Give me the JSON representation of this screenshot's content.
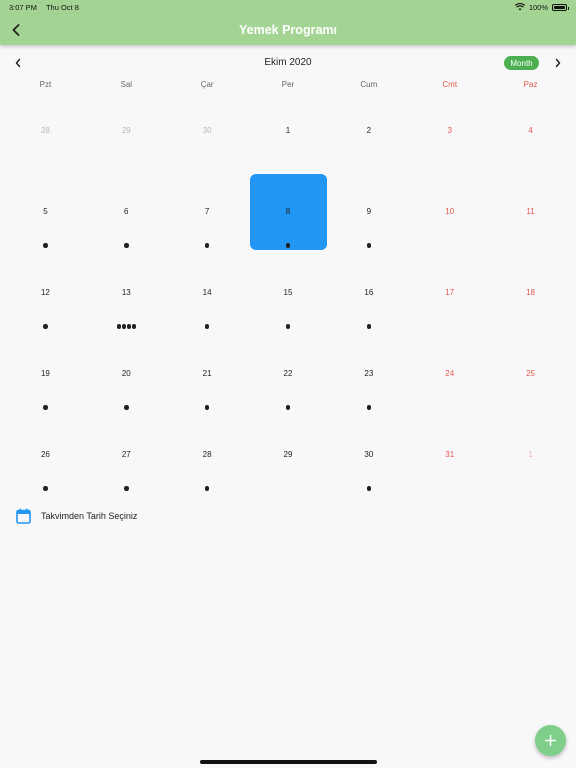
{
  "status_bar": {
    "time": "3:07 PM",
    "date": "Thu Oct 8",
    "battery": "100%",
    "battery_level": 1.0
  },
  "nav": {
    "title": "Yemek Programı",
    "back_icon": "chevron-left-icon"
  },
  "calendar": {
    "month_title": "Ekim 2020",
    "format_label": "Month",
    "weekdays": [
      {
        "label": "Pzt",
        "weekend": false
      },
      {
        "label": "Sal",
        "weekend": false
      },
      {
        "label": "Çar",
        "weekend": false
      },
      {
        "label": "Per",
        "weekend": false
      },
      {
        "label": "Cum",
        "weekend": false
      },
      {
        "label": "Cmt",
        "weekend": true
      },
      {
        "label": "Paz",
        "weekend": true
      }
    ],
    "selected_day": "8",
    "selected_color": "#2196f3",
    "weekend_color": "#e4584a",
    "weeks": [
      [
        {
          "day": "28",
          "outside": true,
          "events": 0
        },
        {
          "day": "29",
          "outside": true,
          "events": 0
        },
        {
          "day": "30",
          "outside": true,
          "events": 0
        },
        {
          "day": "1",
          "events": 0
        },
        {
          "day": "2",
          "events": 0
        },
        {
          "day": "3",
          "events": 0
        },
        {
          "day": "4",
          "events": 0
        }
      ],
      [
        {
          "day": "5",
          "events": 1
        },
        {
          "day": "6",
          "events": 1
        },
        {
          "day": "7",
          "events": 1
        },
        {
          "day": "8",
          "events": 1,
          "selected": true
        },
        {
          "day": "9",
          "events": 1
        },
        {
          "day": "10",
          "events": 0
        },
        {
          "day": "11",
          "events": 0
        }
      ],
      [
        {
          "day": "12",
          "events": 1
        },
        {
          "day": "13",
          "events": 4
        },
        {
          "day": "14",
          "events": 1
        },
        {
          "day": "15",
          "events": 1
        },
        {
          "day": "16",
          "events": 1
        },
        {
          "day": "17",
          "events": 0
        },
        {
          "day": "18",
          "events": 0
        }
      ],
      [
        {
          "day": "19",
          "events": 1
        },
        {
          "day": "20",
          "events": 1
        },
        {
          "day": "21",
          "events": 1
        },
        {
          "day": "22",
          "events": 1
        },
        {
          "day": "23",
          "events": 1
        },
        {
          "day": "24",
          "events": 0
        },
        {
          "day": "25",
          "events": 0
        }
      ],
      [
        {
          "day": "26",
          "events": 1
        },
        {
          "day": "27",
          "events": 1
        },
        {
          "day": "28",
          "events": 1
        },
        {
          "day": "29",
          "events": 0
        },
        {
          "day": "30",
          "events": 1
        },
        {
          "day": "31",
          "events": 0
        },
        {
          "day": "1",
          "outside": true,
          "events": 0
        }
      ]
    ]
  },
  "date_picker": {
    "label": "Takvimden Tarih Seçiniz",
    "icon": "calendar-icon"
  },
  "fab": {
    "icon": "plus-icon"
  }
}
